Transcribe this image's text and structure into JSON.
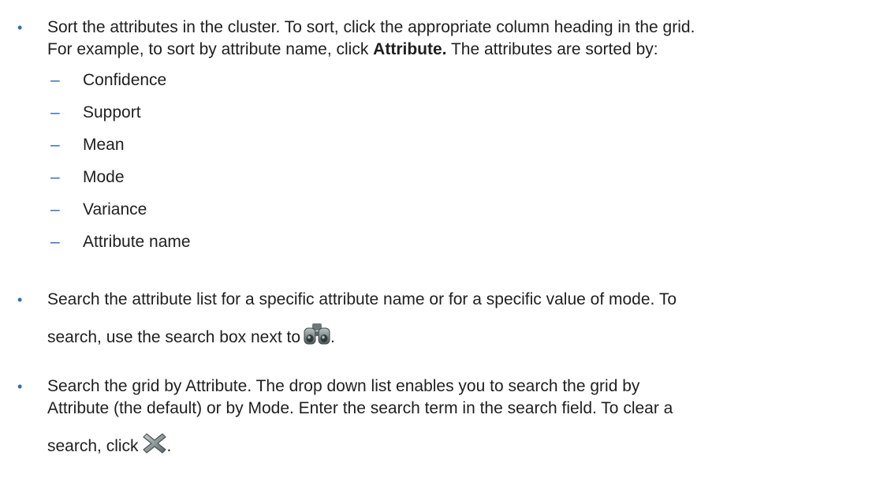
{
  "colors": {
    "text": "#1f1f1f",
    "bullet": "#2e6db4"
  },
  "bullet_symbol": "•",
  "dash_symbol": "–",
  "bullet1": {
    "line1": "Sort the attributes in the cluster. To sort, click the appropriate column heading in the grid.",
    "line2_pre": "For example, to sort by attribute name, click ",
    "line2_bold": "Attribute.",
    "line2_post": " The attributes are sorted by:"
  },
  "sort_items": [
    "Confidence",
    "Support",
    "Mean",
    "Mode",
    "Variance",
    "Attribute name"
  ],
  "bullet2": {
    "line1": "Search the attribute list for a specific attribute name or for a specific value of mode. To",
    "line2_pre": "search, use the search box next to",
    "line2_post": ".",
    "icon": "binoculars-icon"
  },
  "bullet3": {
    "line1": "Search the grid by Attribute. The drop down list enables you to search the grid by",
    "line2": "Attribute (the default) or by Mode. Enter the search term in the search field. To clear a",
    "line3_pre": "search, click",
    "line3_post": ".",
    "icon": "clear-x-icon"
  }
}
